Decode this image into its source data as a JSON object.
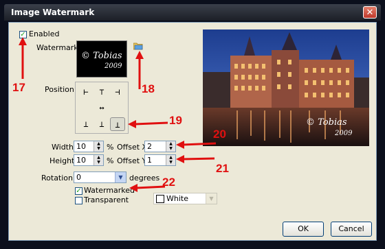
{
  "window": {
    "title": "Image Watermark"
  },
  "enabled": {
    "label": "Enabled",
    "checked": true
  },
  "watermark": {
    "label": "Watermark",
    "thumb_line1": "© Tobias",
    "thumb_line2": "2009"
  },
  "position": {
    "label": "Position",
    "glyphs": [
      "⊢",
      "⊤",
      "⊣",
      "⊢",
      "↔",
      "⊣",
      "⊥",
      "⊥",
      "⊥"
    ]
  },
  "size": {
    "width_label": "Width",
    "width_value": "10",
    "height_label": "Height",
    "height_value": "10",
    "percent": "%"
  },
  "offset": {
    "x_label": "Offset X",
    "x_value": "2",
    "y_label": "Offset Y",
    "y_value": "1"
  },
  "rotation": {
    "label": "Rotation",
    "value": "0",
    "unit": "degrees"
  },
  "watermarked": {
    "label": "Watermarked",
    "checked": true
  },
  "transparent": {
    "label": "Transparent",
    "checked": false
  },
  "color": {
    "value": "White"
  },
  "preview": {
    "watermark_line1": "© Tobias",
    "watermark_line2": "2009"
  },
  "buttons": {
    "ok": "OK",
    "cancel": "Cancel"
  },
  "annotations": [
    "17",
    "18",
    "19",
    "20",
    "21",
    "22"
  ],
  "colors": {
    "annotation": "#e01010",
    "title_bg": "#2a2e38",
    "dialog_bg": "#ece9d8"
  }
}
